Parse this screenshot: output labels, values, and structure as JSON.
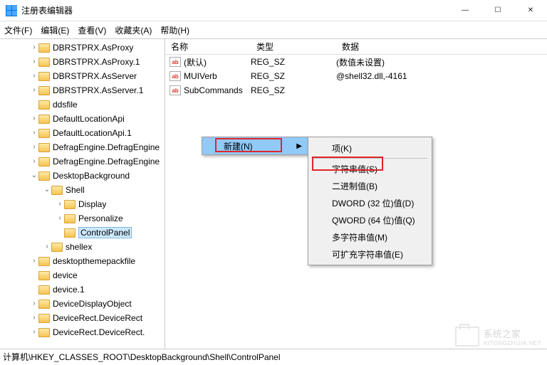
{
  "window": {
    "title": "注册表编辑器",
    "controls": {
      "min": "—",
      "max": "☐",
      "close": "✕"
    }
  },
  "menubar": [
    "文件(F)",
    "编辑(E)",
    "查看(V)",
    "收藏夹(A)",
    "帮助(H)"
  ],
  "tree": [
    {
      "indent": 42,
      "exp": ">",
      "label": "DBRSTPRX.AsProxy"
    },
    {
      "indent": 42,
      "exp": ">",
      "label": "DBRSTPRX.AsProxy.1"
    },
    {
      "indent": 42,
      "exp": ">",
      "label": "DBRSTPRX.AsServer"
    },
    {
      "indent": 42,
      "exp": ">",
      "label": "DBRSTPRX.AsServer.1"
    },
    {
      "indent": 42,
      "exp": "",
      "label": "ddsfile"
    },
    {
      "indent": 42,
      "exp": ">",
      "label": "DefaultLocationApi"
    },
    {
      "indent": 42,
      "exp": ">",
      "label": "DefaultLocationApi.1"
    },
    {
      "indent": 42,
      "exp": ">",
      "label": "DefragEngine.DefragEngine"
    },
    {
      "indent": 42,
      "exp": ">",
      "label": "DefragEngine.DefragEngine"
    },
    {
      "indent": 42,
      "exp": "v",
      "label": "DesktopBackground"
    },
    {
      "indent": 60,
      "exp": "v",
      "label": "Shell"
    },
    {
      "indent": 78,
      "exp": ">",
      "label": "Display"
    },
    {
      "indent": 78,
      "exp": ">",
      "label": "Personalize"
    },
    {
      "indent": 78,
      "exp": "",
      "label": "ControlPanel",
      "selected": true
    },
    {
      "indent": 60,
      "exp": ">",
      "label": "shellex"
    },
    {
      "indent": 42,
      "exp": ">",
      "label": "desktopthemepackfile"
    },
    {
      "indent": 42,
      "exp": "",
      "label": "device"
    },
    {
      "indent": 42,
      "exp": "",
      "label": "device.1"
    },
    {
      "indent": 42,
      "exp": ">",
      "label": "DeviceDisplayObject"
    },
    {
      "indent": 42,
      "exp": ">",
      "label": "DeviceRect.DeviceRect"
    },
    {
      "indent": 42,
      "exp": ">",
      "label": "DeviceRect.DeviceRect."
    }
  ],
  "list": {
    "headers": {
      "name": "名称",
      "type": "类型",
      "data": "数据"
    },
    "rows": [
      {
        "name": "(默认)",
        "type": "REG_SZ",
        "data": "(数值未设置)"
      },
      {
        "name": "MUIVerb",
        "type": "REG_SZ",
        "data": "@shell32.dll,-4161"
      },
      {
        "name": "SubCommands",
        "type": "REG_SZ",
        "data": ""
      }
    ]
  },
  "contextMenu": {
    "parent": {
      "label": "新建(N)",
      "arrow": "▶"
    },
    "items": [
      {
        "label": "项(K)",
        "sep_after": true
      },
      {
        "label": "字符串值(S)",
        "highlight": true
      },
      {
        "label": "二进制值(B)"
      },
      {
        "label": "DWORD (32 位)值(D)"
      },
      {
        "label": "QWORD (64 位)值(Q)"
      },
      {
        "label": "多字符串值(M)"
      },
      {
        "label": "可扩充字符串值(E)"
      }
    ]
  },
  "statusbar": "计算机\\HKEY_CLASSES_ROOT\\DesktopBackground\\Shell\\ControlPanel",
  "watermark": {
    "text1": "系统之家",
    "text2": "XITONGZHIJIA.NET"
  },
  "ab_label": "ab"
}
